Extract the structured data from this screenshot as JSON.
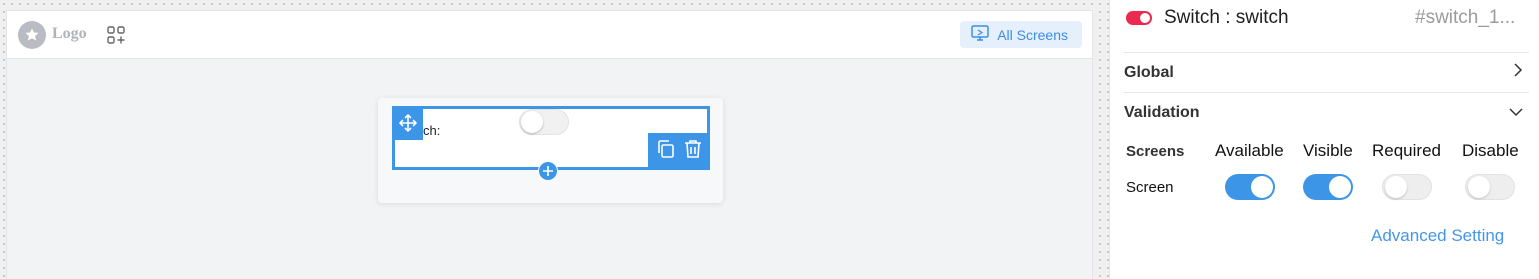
{
  "canvas": {
    "logo_text": "Logo",
    "screens_button_label": "All Screens",
    "field": {
      "label": "ch:",
      "switch_state": "off"
    }
  },
  "panel": {
    "title": "Switch : switch",
    "element_id": "#switch_1...",
    "sections": {
      "global_label": "Global",
      "validation_label": "Validation"
    },
    "validation_table": {
      "headers": [
        "Screens",
        "Available",
        "Visible",
        "Required",
        "Disable"
      ],
      "rows": [
        {
          "screen": "Screen",
          "available": true,
          "visible": true,
          "required": false,
          "disable": false
        }
      ]
    },
    "advanced_setting_label": "Advanced Setting"
  },
  "colors": {
    "accent": "#3d95e8",
    "switch_icon": "#ea2a4f",
    "screens_button_bg": "#e6f0fc"
  },
  "icons": {
    "logo": "star-icon",
    "apps": "apps-grid-icon",
    "screens": "monitor-icon",
    "move": "move-arrows-icon",
    "copy": "copy-icon",
    "delete": "trash-icon",
    "add": "plus-icon",
    "global_chevron": "chevron-right-icon",
    "validation_chevron": "chevron-down-icon"
  }
}
